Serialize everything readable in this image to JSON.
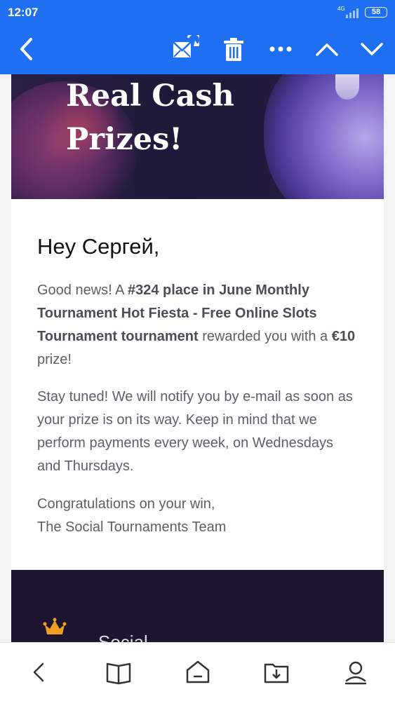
{
  "status_bar": {
    "time": "12:07",
    "network": "4G",
    "battery": "58"
  },
  "toolbar": {
    "back_icon": "chevron-left-icon",
    "mark_unread_icon": "envelope-unread-icon",
    "delete_icon": "trash-icon",
    "more_icon": "more-dots-icon",
    "previous_icon": "chevron-up-icon",
    "next_icon": "chevron-down-icon",
    "color": "#1f6ff2"
  },
  "hero": {
    "title_line1": "Real Cash",
    "title_line2": "Prizes!"
  },
  "email": {
    "greeting": "Hey Сергей,",
    "p1_a": "Good news! A ",
    "p1_b": "#324 place in June Monthly Tournament Hot Fiesta - Free Online Slots Tournament tournament",
    "p1_c": " rewarded you with a ",
    "p1_d": "€10",
    "p1_e": " prize!",
    "p2": "Stay tuned! We will notify you by e-mail as soon as your prize is on its way. Keep in mind that we perform payments every week, on Wednesdays and Thursdays.",
    "p3_line1": "Congratulations on your win,",
    "p3_line2": "The Social Tournaments Team"
  },
  "footer": {
    "logo_partial": "Social"
  },
  "bottom_nav": {
    "items": [
      "back-icon",
      "book-icon",
      "home-icon",
      "folder-download-icon",
      "profile-icon"
    ]
  }
}
